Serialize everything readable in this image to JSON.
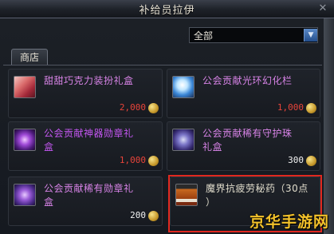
{
  "window": {
    "title": "补给员拉伊"
  },
  "filter": {
    "selected": "全部"
  },
  "tabs": [
    {
      "label": "商店"
    }
  ],
  "items": [
    {
      "name_lines": [
        "甜甜巧克力装扮礼盒"
      ],
      "price": "2,000",
      "price_color": "#e8443a",
      "name_color": "#d783e6",
      "icon": "chocolate-gift-box-icon"
    },
    {
      "name_lines": [
        "公会贡献光环幻化栏"
      ],
      "price": "1,000",
      "price_color": "#e8443a",
      "name_color": "#d783e6",
      "icon": "aura-skin-slot-icon"
    },
    {
      "name_lines": [
        "公会贡献神器勋章礼",
        "盒"
      ],
      "price": "1,000",
      "price_color": "#e8443a",
      "name_color": "#c256f0",
      "icon": "artifact-medal-box-icon"
    },
    {
      "name_lines": [
        "公会贡献稀有守护珠",
        "礼盒"
      ],
      "price": "300",
      "price_color": "#f2f2f2",
      "name_color": "#d783e6",
      "icon": "guardian-orb-box-icon"
    },
    {
      "name_lines": [
        "公会贡献稀有勋章礼",
        "盒"
      ],
      "price": "200",
      "price_color": "#f2f2f2",
      "name_color": "#d783e6",
      "icon": "rare-medal-box-icon"
    },
    {
      "name_lines": [
        "魔界抗疲劳秘药（30点",
        "）"
      ],
      "price": "",
      "price_color": "#f2f2f2",
      "name_color": "#e0dccb",
      "icon": "fatigue-potion-icon"
    }
  ],
  "watermark": "京华手游网",
  "colors": {
    "highlight_border": "#e0281f",
    "dropdown_arrow": "#3a6db0"
  }
}
